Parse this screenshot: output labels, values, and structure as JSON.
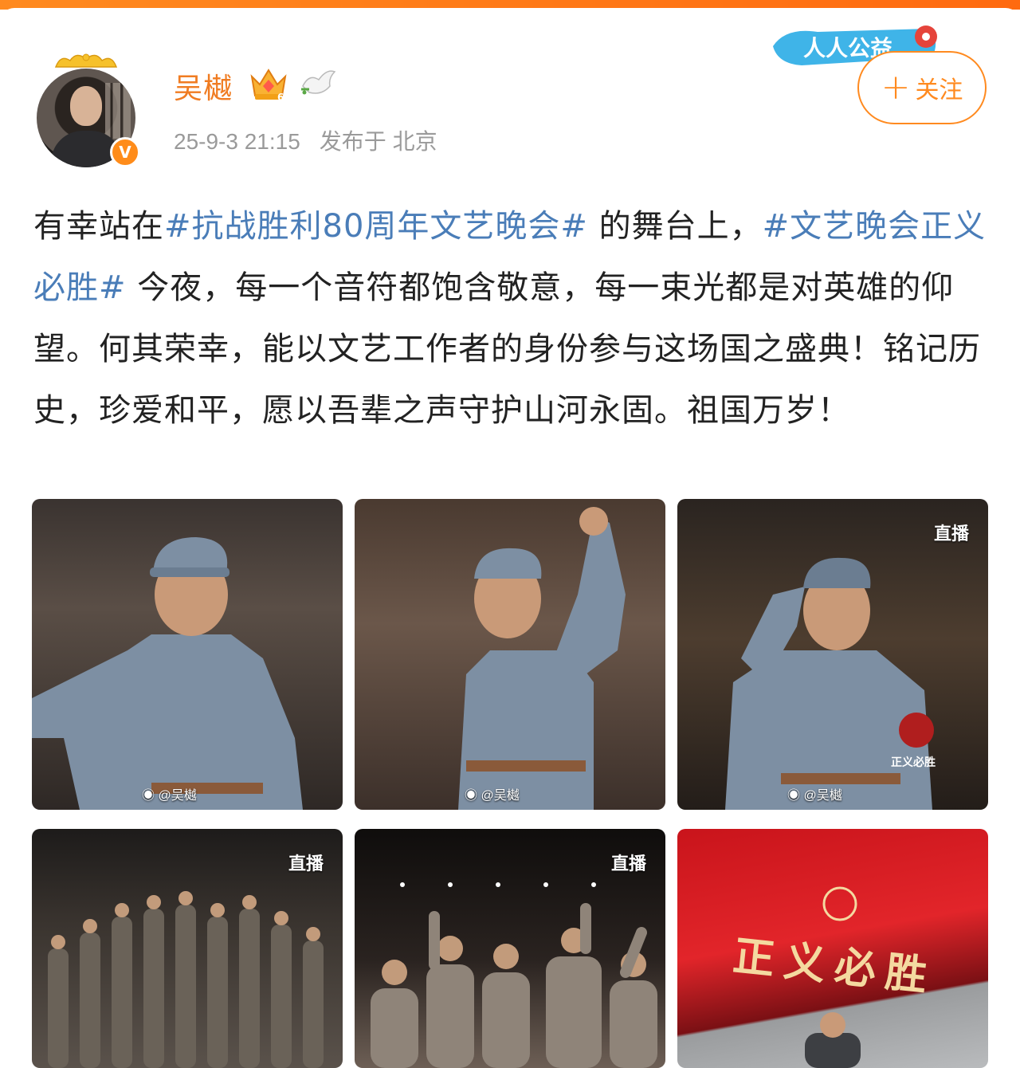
{
  "post": {
    "username": "吴樾",
    "timestamp": "25-9-3 21:15",
    "location_text": "发布于 北京",
    "follow_plus": "+",
    "follow_label": "关注",
    "verified_badge": "V",
    "ribbon_text": "人人公益",
    "text_parts": {
      "p1": "有幸站在",
      "tag1": "#抗战胜利80周年文艺晚会#",
      "p2": " 的舞台上，",
      "tag2": "#文艺晚会正义必胜#",
      "p3": " 今夜，每一个音符都饱含敬意，每一束光都是对英雄的仰望。何其荣幸，能以文艺工作者的身份参与这场国之盛典！铭记历史，珍爱和平，愿以吾辈之声守护山河永固。祖国万岁！"
    }
  },
  "images": [
    {
      "watermark": "@吴樾",
      "live": ""
    },
    {
      "watermark": "@吴樾",
      "live": ""
    },
    {
      "watermark": "@吴樾",
      "live": "直播",
      "stage_text": "正义必胜"
    },
    {
      "watermark": "",
      "live": "直播"
    },
    {
      "watermark": "",
      "live": "直播"
    },
    {
      "watermark": "",
      "live": "",
      "stage_text": "正义必胜"
    }
  ],
  "colors": {
    "accent": "#ff8a1f",
    "username": "#f07c22",
    "hashtag": "#4a7db8",
    "meta": "#9a9a9a"
  },
  "icons": [
    "crown-frame-icon",
    "vip-crown-icon",
    "dove-icon",
    "verified-v-icon",
    "plus-icon",
    "weibo-logo-icon"
  ]
}
